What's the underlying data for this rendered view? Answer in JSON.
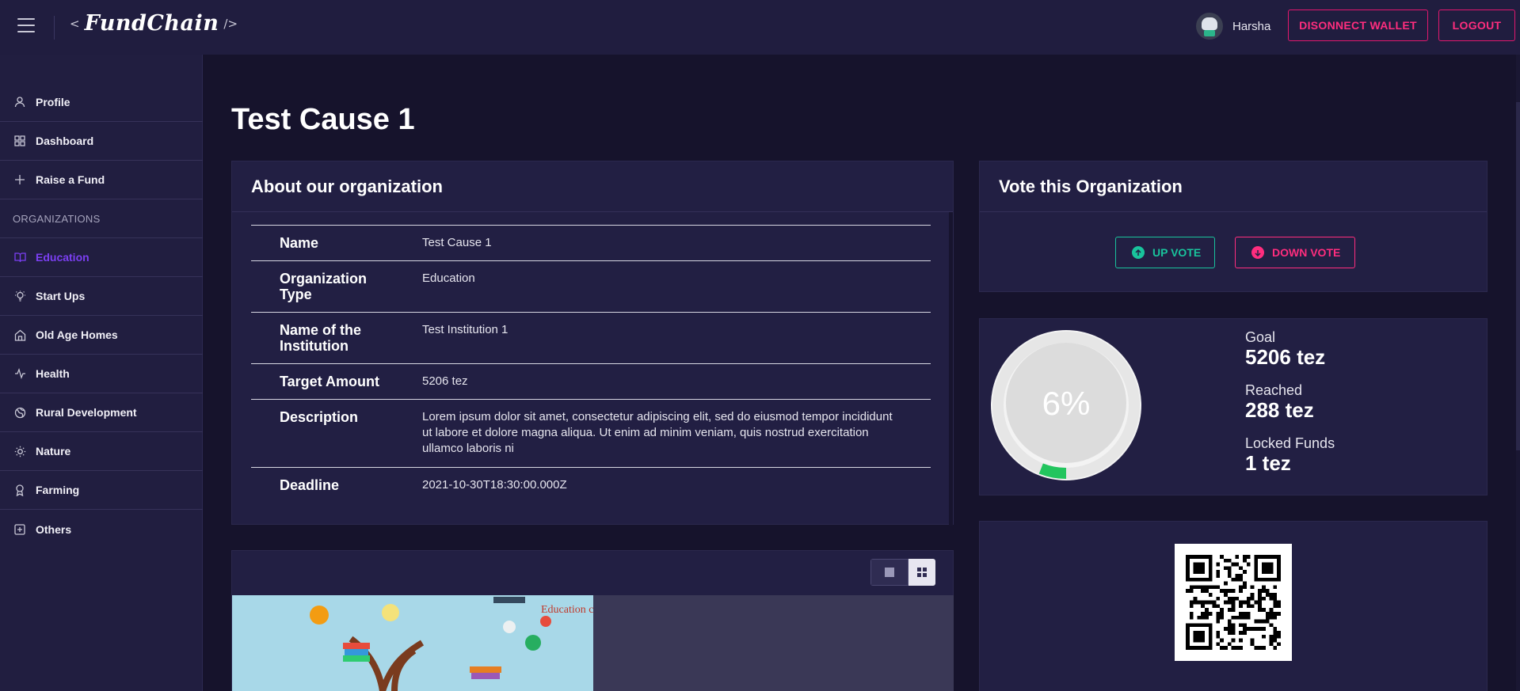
{
  "header": {
    "logo_left_bracket": "<",
    "logo_text": "FundChain",
    "logo_right_bracket": "/>",
    "user_name": "Harsha",
    "disconnect_label": "DISONNECT WALLET",
    "logout_label": "LOGOUT"
  },
  "sidebar": {
    "items_top": [
      {
        "label": "Profile",
        "icon": "user-icon"
      },
      {
        "label": "Dashboard",
        "icon": "grid-icon"
      },
      {
        "label": "Raise a Fund",
        "icon": "plus-icon"
      }
    ],
    "section_label": "ORGANIZATIONS",
    "items_orgs": [
      {
        "label": "Education",
        "icon": "book-icon",
        "active": true
      },
      {
        "label": "Start Ups",
        "icon": "lightbulb-icon"
      },
      {
        "label": "Old Age Homes",
        "icon": "home-icon"
      },
      {
        "label": "Health",
        "icon": "activity-icon"
      },
      {
        "label": "Rural Development",
        "icon": "globe-icon"
      },
      {
        "label": "Nature",
        "icon": "sun-icon"
      },
      {
        "label": "Farming",
        "icon": "award-icon"
      },
      {
        "label": "Others",
        "icon": "plus-square-icon"
      }
    ],
    "active_color": "#7b3ff2"
  },
  "main": {
    "title": "Test Cause 1",
    "about": {
      "heading": "About our organization",
      "rows": [
        {
          "key": "Name",
          "value": "Test Cause 1"
        },
        {
          "key": "Organization Type",
          "value": "Education"
        },
        {
          "key": "Name of the Institution",
          "value": "Test Institution 1"
        },
        {
          "key": "Target Amount",
          "value": "5206 tez"
        },
        {
          "key": "Description",
          "value": "Lorem ipsum dolor sit amet, consectetur adipiscing elit, sed do eiusmod tempor incididunt ut labore et dolore magna aliqua. Ut enim ad minim veniam, quis nostrud exercitation ullamco laboris ni"
        },
        {
          "key": "Deadline",
          "value": "2021-10-30T18:30:00.000Z"
        }
      ]
    },
    "vote": {
      "heading": "Vote this Organization",
      "up_label": "UP VOTE",
      "down_label": "DOWN VOTE",
      "up_color": "#19c39c",
      "down_color": "#ff2d7e"
    },
    "progress": {
      "percent_label": "6%",
      "percent": 6,
      "goal_label": "Goal",
      "goal_value": "5206 tez",
      "reached_label": "Reached",
      "reached_value": "288 tez",
      "locked_label": "Locked Funds",
      "locked_value": "1 tez"
    },
    "gallery": {
      "image_text": "Education corner"
    }
  }
}
